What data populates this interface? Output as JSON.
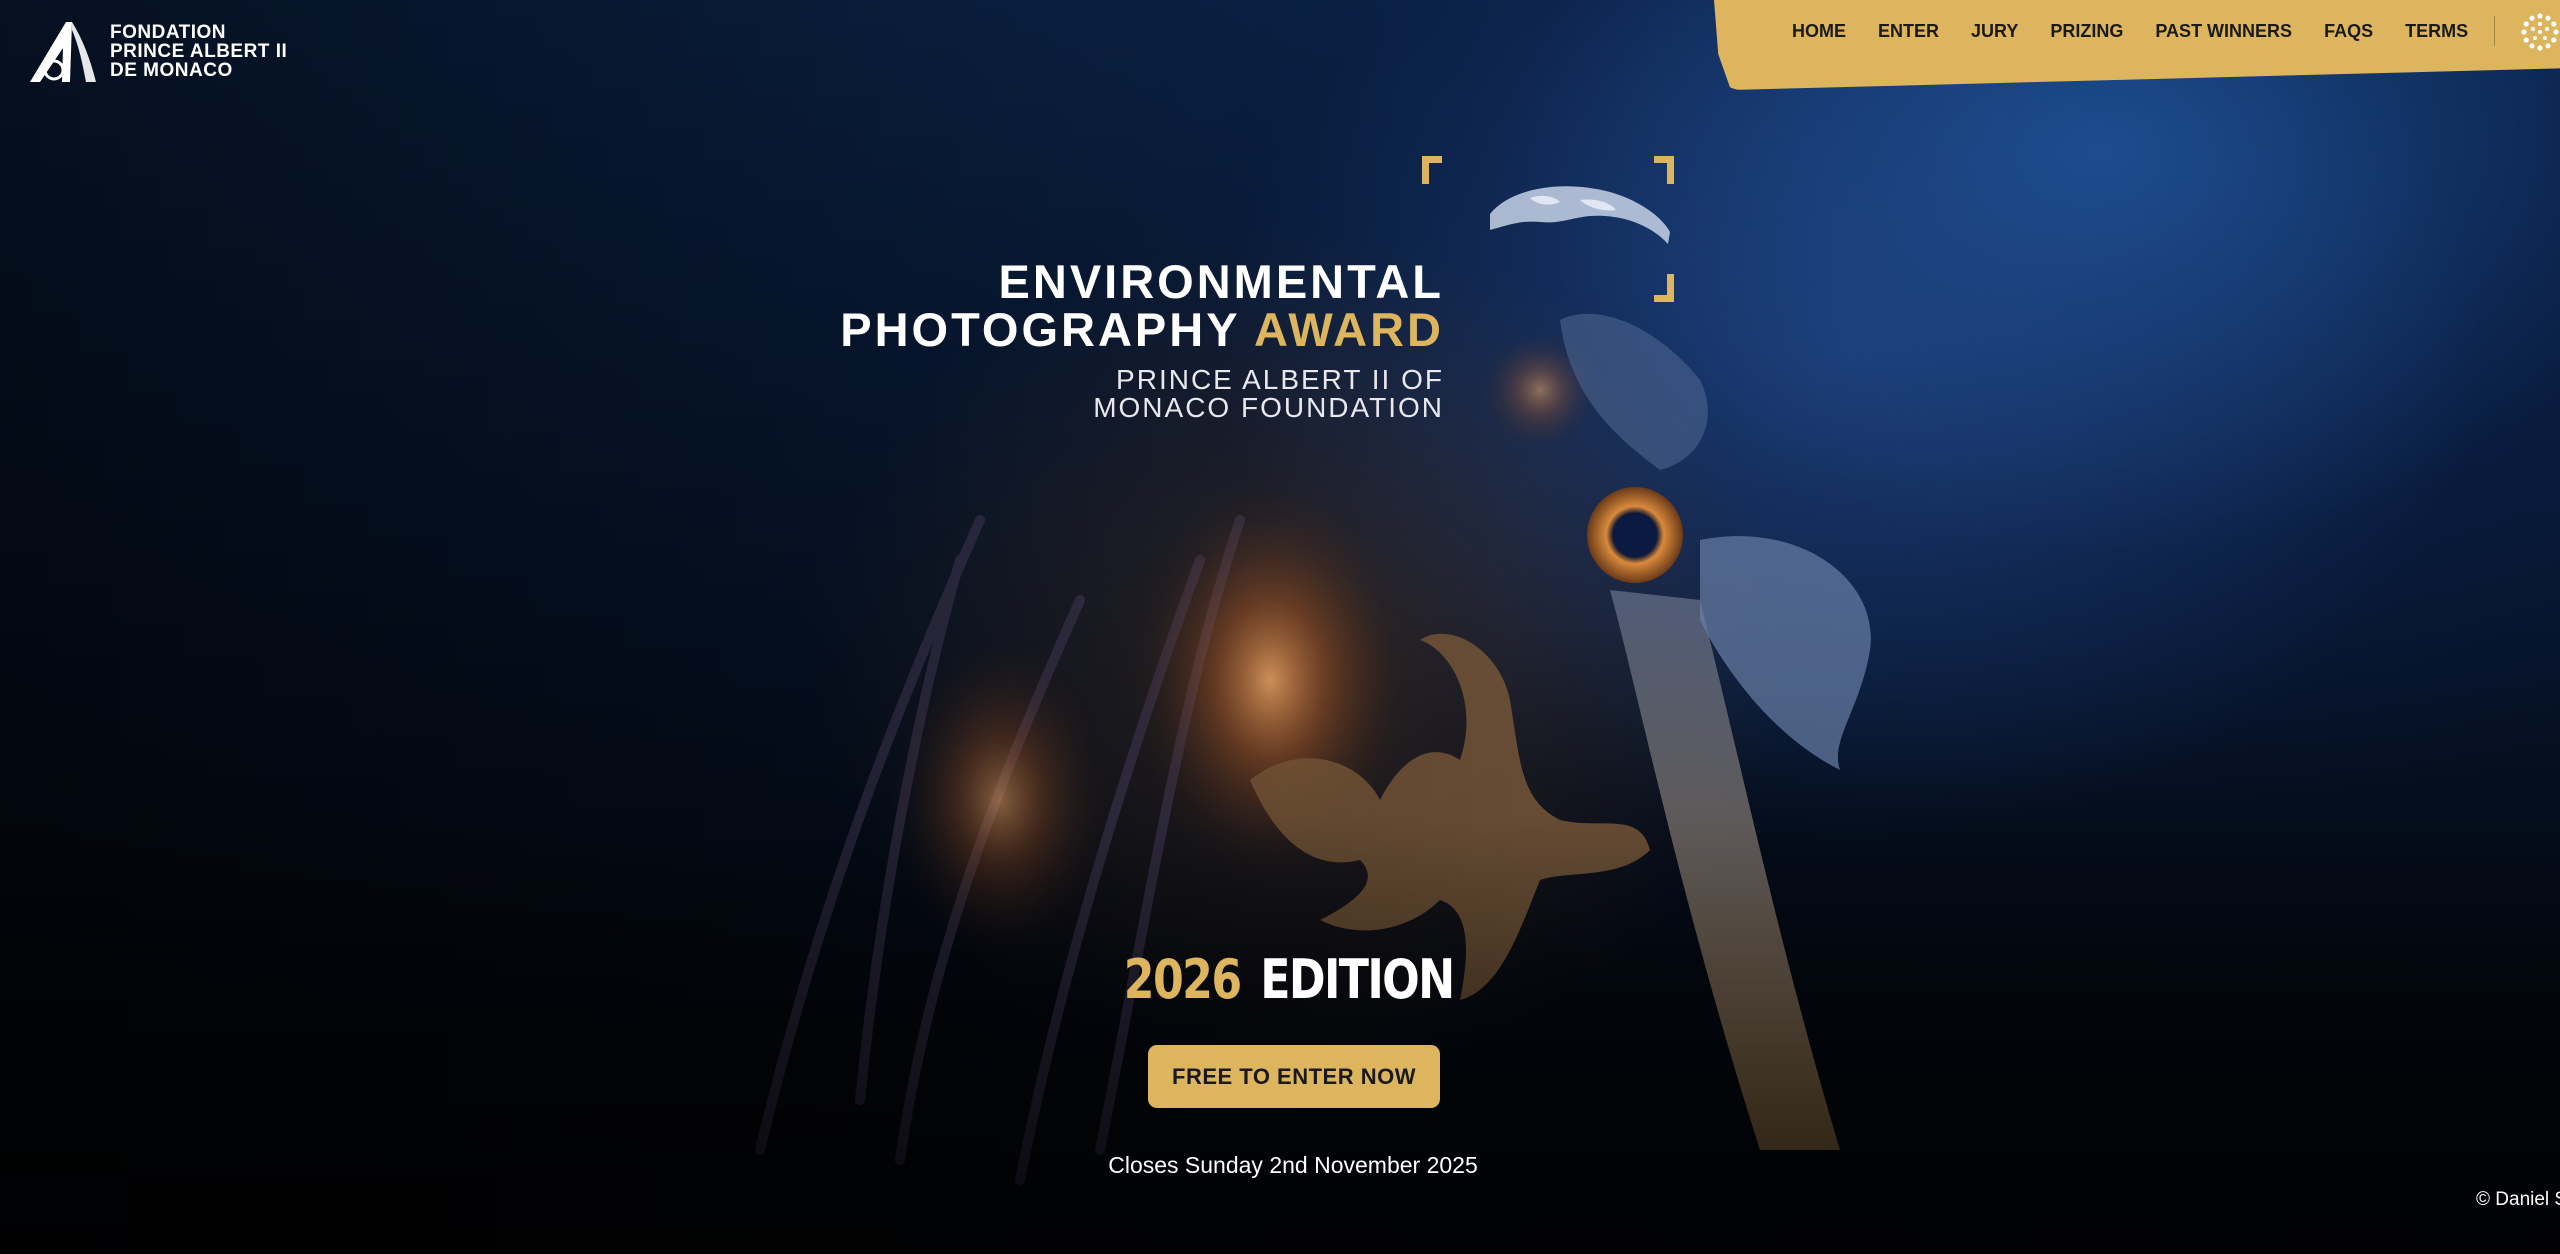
{
  "logo": {
    "line1": "FONDATION",
    "line2": "PRINCE ALBERT II",
    "line3": "DE MONACO"
  },
  "nav": {
    "items": [
      {
        "label": "HOME"
      },
      {
        "label": "ENTER"
      },
      {
        "label": "JURY"
      },
      {
        "label": "PRIZING"
      },
      {
        "label": "PAST WINNERS"
      },
      {
        "label": "FAQS"
      },
      {
        "label": "TERMS"
      }
    ],
    "icon": "sunburst-dots-icon"
  },
  "hero": {
    "title_line1": "ENVIRONMENTAL",
    "title_line2_white": "PHOTOGRAPHY",
    "title_line2_gold": "AWARD",
    "subtitle_line1": "PRINCE ALBERT II OF",
    "subtitle_line2": "MONACO FOUNDATION",
    "edition_year": "2026",
    "edition_word": "EDITION",
    "cta_label": "FREE TO ENTER NOW",
    "closes_text": "Closes Sunday 2nd November 2025",
    "photo_credit": "© Daniel S"
  },
  "colors": {
    "accent_gold": "#dcb55e",
    "background_navy": "#0b2348",
    "text_dark": "#1a1a1a"
  }
}
